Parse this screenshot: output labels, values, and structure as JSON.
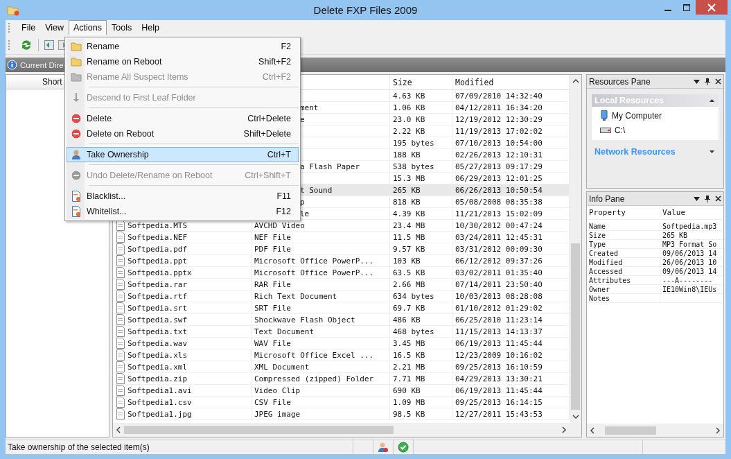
{
  "window": {
    "title": "Delete FXP Files 2009"
  },
  "menu_bar": [
    {
      "label": "File",
      "selected": false
    },
    {
      "label": "View",
      "selected": false
    },
    {
      "label": "Actions",
      "selected": true
    },
    {
      "label": "Tools",
      "selected": false
    },
    {
      "label": "Help",
      "selected": false
    }
  ],
  "actions_menu": [
    {
      "kind": "item",
      "label": "Rename",
      "shortcut": "F2",
      "disabled": false,
      "selected": false
    },
    {
      "kind": "item",
      "label": "Rename on Reboot",
      "shortcut": "Shift+F2",
      "disabled": false,
      "selected": false
    },
    {
      "kind": "item",
      "label": "Rename All Suspect Items",
      "shortcut": "Ctrl+F2",
      "disabled": true,
      "selected": false
    },
    {
      "kind": "separator"
    },
    {
      "kind": "item",
      "label": "Descend to First Leaf Folder",
      "disabled": true,
      "selected": false
    },
    {
      "kind": "separator"
    },
    {
      "kind": "item",
      "label": "Delete",
      "shortcut": "Ctrl+Delete",
      "disabled": false,
      "selected": false
    },
    {
      "kind": "item",
      "label": "Delete on Reboot",
      "shortcut": "Shift+Delete",
      "disabled": false,
      "selected": false
    },
    {
      "kind": "separator"
    },
    {
      "kind": "item",
      "label": "Take Ownership",
      "shortcut": "Ctrl+T",
      "disabled": false,
      "selected": true
    },
    {
      "kind": "separator"
    },
    {
      "kind": "item",
      "label": "Undo Delete/Rename on Reboot",
      "shortcut": "Ctrl+Shift+T",
      "disabled": true,
      "selected": false
    },
    {
      "kind": "separator"
    },
    {
      "kind": "item",
      "label": "Blacklist...",
      "shortcut": "F11",
      "disabled": false,
      "selected": false
    },
    {
      "kind": "item",
      "label": "Whitelist...",
      "shortcut": "F12",
      "disabled": false,
      "selected": false
    }
  ],
  "current_directory": {
    "label": "Current Dire"
  },
  "shortcuts_pane": {
    "header": "Short"
  },
  "file_list": {
    "columns": {
      "size": "Size",
      "modified": "Modified"
    },
    "rows": [
      {
        "kind": "covered",
        "size": "4.63 KB",
        "modified": "07/09/2010 14:32:40",
        "selected": false
      },
      {
        "kind": "covered",
        "type": "ment",
        "size": "1.06 KB",
        "modified": "04/12/2011 16:34:20",
        "selected": false
      },
      {
        "kind": "covered",
        "type": "e",
        "size": "23.0 KB",
        "modified": "12/19/2012 12:30:29",
        "selected": false
      },
      {
        "kind": "covered",
        "size": "2.22 KB",
        "modified": "11/19/2013 17:02:02",
        "selected": false
      },
      {
        "kind": "covered",
        "size": "195 bytes",
        "modified": "07/10/2013 10:54:00",
        "selected": false
      },
      {
        "kind": "covered",
        "size": "188 KB",
        "modified": "02/26/2013 12:10:31",
        "selected": false
      },
      {
        "kind": "covered",
        "type": "a Flash Paper",
        "size": "538 bytes",
        "modified": "05/27/2013 09:17:29",
        "selected": false
      },
      {
        "kind": "covered",
        "size": "15.3 MB",
        "modified": "06/29/2013 12:01:25",
        "selected": false
      },
      {
        "kind": "covered",
        "type": "t Sound",
        "size": "265 KB",
        "modified": "06/26/2013 10:50:54",
        "selected": true
      },
      {
        "kind": "covered",
        "type": "p",
        "size": "818 KB",
        "modified": "05/08/2008 08:35:38",
        "selected": false
      },
      {
        "kind": "covered",
        "type": "le",
        "size": "4.39 KB",
        "modified": "11/21/2013 15:02:09",
        "selected": false
      },
      {
        "kind": "file",
        "name": "Softpedia.MTS",
        "type": "AVCHD Video",
        "size": "23.4 MB",
        "modified": "10/30/2012 00:47:24",
        "selected": false
      },
      {
        "kind": "file",
        "name": "Softpedia.NEF",
        "type": "NEF File",
        "size": "11.5 MB",
        "modified": "03/24/2011 12:45:31",
        "selected": false
      },
      {
        "kind": "file",
        "name": "Softpedia.pdf",
        "type": "PDF File",
        "size": "9.57 KB",
        "modified": "03/31/2012 00:09:30",
        "selected": false
      },
      {
        "kind": "file",
        "name": "Softpedia.ppt",
        "type": "Microsoft Office PowerP...",
        "size": "103 KB",
        "modified": "06/12/2012 09:37:26",
        "selected": false
      },
      {
        "kind": "file",
        "name": "Softpedia.pptx",
        "type": "Microsoft Office PowerP...",
        "size": "63.5 KB",
        "modified": "03/02/2011 01:35:40",
        "selected": false
      },
      {
        "kind": "file",
        "name": "Softpedia.rar",
        "type": "RAR File",
        "size": "2.66 MB",
        "modified": "07/14/2011 23:50:40",
        "selected": false
      },
      {
        "kind": "file",
        "name": "Softpedia.rtf",
        "type": "Rich Text Document",
        "size": "634 bytes",
        "modified": "10/03/2013 08:28:08",
        "selected": false
      },
      {
        "kind": "file",
        "name": "Softpedia.srt",
        "type": "SRT File",
        "size": "69.7 KB",
        "modified": "01/10/2012 01:29:02",
        "selected": false
      },
      {
        "kind": "file",
        "name": "Softpedia.swf",
        "type": "Shockwave Flash Object",
        "size": "486 KB",
        "modified": "06/25/2010 11:23:14",
        "selected": false
      },
      {
        "kind": "file",
        "name": "Softpedia.txt",
        "type": "Text Document",
        "size": "468 bytes",
        "modified": "11/15/2013 14:13:37",
        "selected": false
      },
      {
        "kind": "file",
        "name": "Softpedia.wav",
        "type": "WAV File",
        "size": "3.45 MB",
        "modified": "06/19/2013 11:45:44",
        "selected": false
      },
      {
        "kind": "file",
        "name": "Softpedia.xls",
        "type": "Microsoft Office Excel ...",
        "size": "16.5 KB",
        "modified": "12/23/2009 10:16:02",
        "selected": false
      },
      {
        "kind": "file",
        "name": "Softpedia.xml",
        "type": "XML Document",
        "size": "2.21 MB",
        "modified": "09/25/2013 16:10:59",
        "selected": false
      },
      {
        "kind": "file",
        "name": "Softpedia.zip",
        "type": "Compressed (zipped) Folder",
        "size": "7.71 MB",
        "modified": "04/29/2013 13:30:21",
        "selected": false
      },
      {
        "kind": "file",
        "name": "Softpedia1.avi",
        "type": "Video Clip",
        "size": "690 KB",
        "modified": "06/19/2013 11:45:44",
        "selected": false
      },
      {
        "kind": "file",
        "name": "Softpedia1.csv",
        "type": "CSV File",
        "size": "1.09 MB",
        "modified": "09/25/2013 16:14:15",
        "selected": false
      },
      {
        "kind": "file",
        "name": "Softpedia1.jpg",
        "type": "JPEG image",
        "size": "98.5 KB",
        "modified": "12/27/2011 15:43:53",
        "selected": false
      }
    ]
  },
  "resources_pane": {
    "title": "Resources Pane",
    "groups": [
      {
        "title": "Local Resources",
        "expanded": true,
        "items": [
          {
            "label": "My Computer"
          },
          {
            "label": "C:\\"
          }
        ]
      },
      {
        "title": "Network Resources",
        "expanded": false
      }
    ]
  },
  "info_pane": {
    "title": "Info Pane",
    "columns": {
      "property": "Property",
      "value": "Value"
    },
    "rows": [
      {
        "property": "Name",
        "value": "Softpedia.mp3"
      },
      {
        "property": "Size",
        "value": "265 KB"
      },
      {
        "property": "Type",
        "value": "MP3 Format So"
      },
      {
        "property": "Created",
        "value": "09/06/2013 14"
      },
      {
        "property": "Modified",
        "value": "26/06/2013 10"
      },
      {
        "property": "Accessed",
        "value": "09/06/2013 14"
      },
      {
        "property": "Attributes",
        "value": "---A--------"
      },
      {
        "property": "Owner",
        "value": "IE10Win8\\IEUs"
      },
      {
        "property": "Notes"
      }
    ]
  },
  "status_bar": {
    "text": "Take ownership of the selected item(s)"
  }
}
